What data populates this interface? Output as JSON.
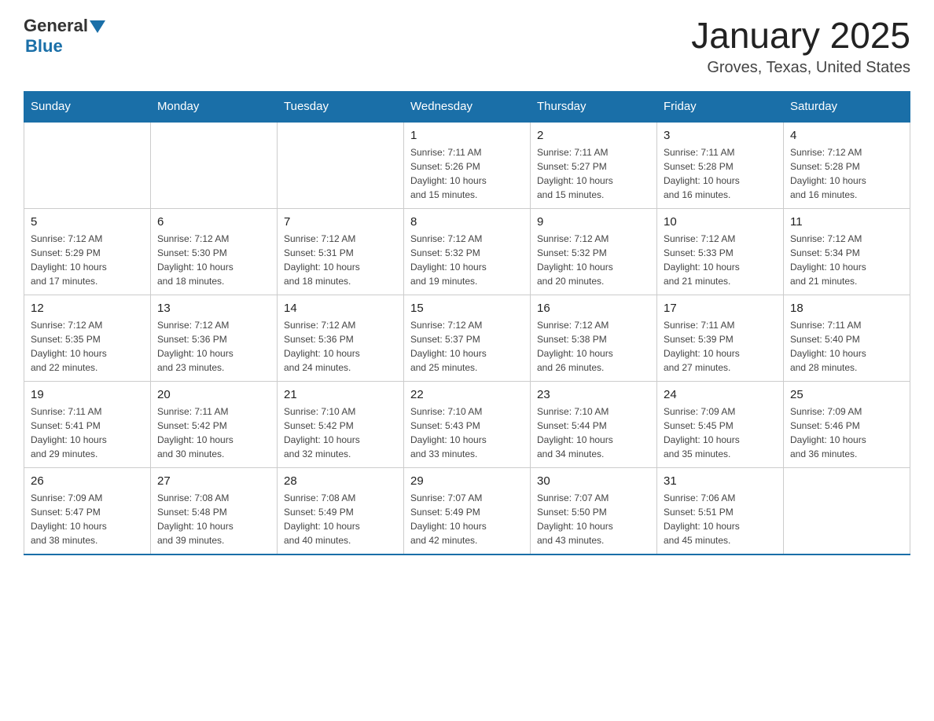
{
  "header": {
    "logo_general": "General",
    "logo_blue": "Blue",
    "title": "January 2025",
    "subtitle": "Groves, Texas, United States"
  },
  "days_of_week": [
    "Sunday",
    "Monday",
    "Tuesday",
    "Wednesday",
    "Thursday",
    "Friday",
    "Saturday"
  ],
  "weeks": [
    [
      {
        "day": "",
        "info": ""
      },
      {
        "day": "",
        "info": ""
      },
      {
        "day": "",
        "info": ""
      },
      {
        "day": "1",
        "info": "Sunrise: 7:11 AM\nSunset: 5:26 PM\nDaylight: 10 hours\nand 15 minutes."
      },
      {
        "day": "2",
        "info": "Sunrise: 7:11 AM\nSunset: 5:27 PM\nDaylight: 10 hours\nand 15 minutes."
      },
      {
        "day": "3",
        "info": "Sunrise: 7:11 AM\nSunset: 5:28 PM\nDaylight: 10 hours\nand 16 minutes."
      },
      {
        "day": "4",
        "info": "Sunrise: 7:12 AM\nSunset: 5:28 PM\nDaylight: 10 hours\nand 16 minutes."
      }
    ],
    [
      {
        "day": "5",
        "info": "Sunrise: 7:12 AM\nSunset: 5:29 PM\nDaylight: 10 hours\nand 17 minutes."
      },
      {
        "day": "6",
        "info": "Sunrise: 7:12 AM\nSunset: 5:30 PM\nDaylight: 10 hours\nand 18 minutes."
      },
      {
        "day": "7",
        "info": "Sunrise: 7:12 AM\nSunset: 5:31 PM\nDaylight: 10 hours\nand 18 minutes."
      },
      {
        "day": "8",
        "info": "Sunrise: 7:12 AM\nSunset: 5:32 PM\nDaylight: 10 hours\nand 19 minutes."
      },
      {
        "day": "9",
        "info": "Sunrise: 7:12 AM\nSunset: 5:32 PM\nDaylight: 10 hours\nand 20 minutes."
      },
      {
        "day": "10",
        "info": "Sunrise: 7:12 AM\nSunset: 5:33 PM\nDaylight: 10 hours\nand 21 minutes."
      },
      {
        "day": "11",
        "info": "Sunrise: 7:12 AM\nSunset: 5:34 PM\nDaylight: 10 hours\nand 21 minutes."
      }
    ],
    [
      {
        "day": "12",
        "info": "Sunrise: 7:12 AM\nSunset: 5:35 PM\nDaylight: 10 hours\nand 22 minutes."
      },
      {
        "day": "13",
        "info": "Sunrise: 7:12 AM\nSunset: 5:36 PM\nDaylight: 10 hours\nand 23 minutes."
      },
      {
        "day": "14",
        "info": "Sunrise: 7:12 AM\nSunset: 5:36 PM\nDaylight: 10 hours\nand 24 minutes."
      },
      {
        "day": "15",
        "info": "Sunrise: 7:12 AM\nSunset: 5:37 PM\nDaylight: 10 hours\nand 25 minutes."
      },
      {
        "day": "16",
        "info": "Sunrise: 7:12 AM\nSunset: 5:38 PM\nDaylight: 10 hours\nand 26 minutes."
      },
      {
        "day": "17",
        "info": "Sunrise: 7:11 AM\nSunset: 5:39 PM\nDaylight: 10 hours\nand 27 minutes."
      },
      {
        "day": "18",
        "info": "Sunrise: 7:11 AM\nSunset: 5:40 PM\nDaylight: 10 hours\nand 28 minutes."
      }
    ],
    [
      {
        "day": "19",
        "info": "Sunrise: 7:11 AM\nSunset: 5:41 PM\nDaylight: 10 hours\nand 29 minutes."
      },
      {
        "day": "20",
        "info": "Sunrise: 7:11 AM\nSunset: 5:42 PM\nDaylight: 10 hours\nand 30 minutes."
      },
      {
        "day": "21",
        "info": "Sunrise: 7:10 AM\nSunset: 5:42 PM\nDaylight: 10 hours\nand 32 minutes."
      },
      {
        "day": "22",
        "info": "Sunrise: 7:10 AM\nSunset: 5:43 PM\nDaylight: 10 hours\nand 33 minutes."
      },
      {
        "day": "23",
        "info": "Sunrise: 7:10 AM\nSunset: 5:44 PM\nDaylight: 10 hours\nand 34 minutes."
      },
      {
        "day": "24",
        "info": "Sunrise: 7:09 AM\nSunset: 5:45 PM\nDaylight: 10 hours\nand 35 minutes."
      },
      {
        "day": "25",
        "info": "Sunrise: 7:09 AM\nSunset: 5:46 PM\nDaylight: 10 hours\nand 36 minutes."
      }
    ],
    [
      {
        "day": "26",
        "info": "Sunrise: 7:09 AM\nSunset: 5:47 PM\nDaylight: 10 hours\nand 38 minutes."
      },
      {
        "day": "27",
        "info": "Sunrise: 7:08 AM\nSunset: 5:48 PM\nDaylight: 10 hours\nand 39 minutes."
      },
      {
        "day": "28",
        "info": "Sunrise: 7:08 AM\nSunset: 5:49 PM\nDaylight: 10 hours\nand 40 minutes."
      },
      {
        "day": "29",
        "info": "Sunrise: 7:07 AM\nSunset: 5:49 PM\nDaylight: 10 hours\nand 42 minutes."
      },
      {
        "day": "30",
        "info": "Sunrise: 7:07 AM\nSunset: 5:50 PM\nDaylight: 10 hours\nand 43 minutes."
      },
      {
        "day": "31",
        "info": "Sunrise: 7:06 AM\nSunset: 5:51 PM\nDaylight: 10 hours\nand 45 minutes."
      },
      {
        "day": "",
        "info": ""
      }
    ]
  ]
}
